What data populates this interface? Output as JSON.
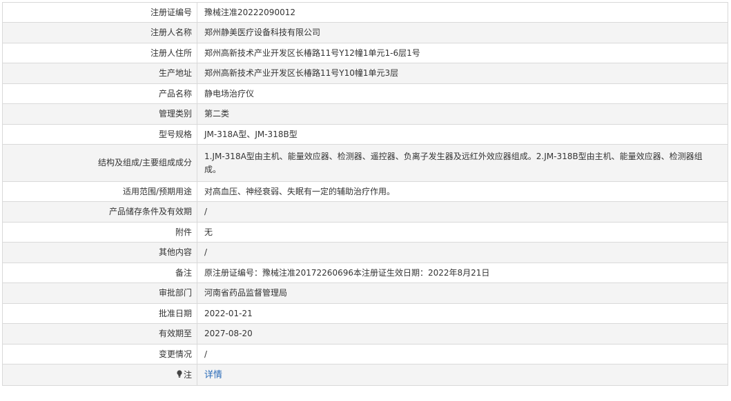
{
  "rows": [
    {
      "label": "注册证编号",
      "value": "豫械注准20222090012"
    },
    {
      "label": "注册人名称",
      "value": "郑州静美医疗设备科技有限公司"
    },
    {
      "label": "注册人住所",
      "value": "郑州高新技术产业开发区长椿路11号Y12幢1单元1-6层1号"
    },
    {
      "label": "生产地址",
      "value": "郑州高新技术产业开发区长椿路11号Y10幢1单元3层"
    },
    {
      "label": "产品名称",
      "value": "静电场治疗仪"
    },
    {
      "label": "管理类别",
      "value": "第二类"
    },
    {
      "label": "型号规格",
      "value": "JM-318A型、JM-318B型"
    },
    {
      "label": "结构及组成/主要组成成分",
      "value": "1.JM-318A型由主机、能量效应器、检测器、遥控器、负离子发生器及远红外效应器组成。2.JM-318B型由主机、能量效应器、检测器组成。"
    },
    {
      "label": "适用范围/预期用途",
      "value": "对高血压、神经衰弱、失眠有一定的辅助治疗作用。"
    },
    {
      "label": "产品储存条件及有效期",
      "value": "/"
    },
    {
      "label": "附件",
      "value": "无"
    },
    {
      "label": "其他内容",
      "value": "/"
    },
    {
      "label": "备注",
      "value": "原注册证编号：豫械注准20172260696本注册证生效日期：2022年8月21日"
    },
    {
      "label": "审批部门",
      "value": "河南省药品监督管理局"
    },
    {
      "label": "批准日期",
      "value": "2022-01-21"
    },
    {
      "label": "有效期至",
      "value": "2027-08-20"
    },
    {
      "label": "变更情况",
      "value": "/"
    }
  ],
  "note": {
    "label": "注",
    "icon": "lightbulb-icon",
    "link_text": "详情",
    "link_color": "#2a6bb8"
  },
  "colors": {
    "border": "#d9d9d9",
    "stripe": "#f4f4f4"
  }
}
